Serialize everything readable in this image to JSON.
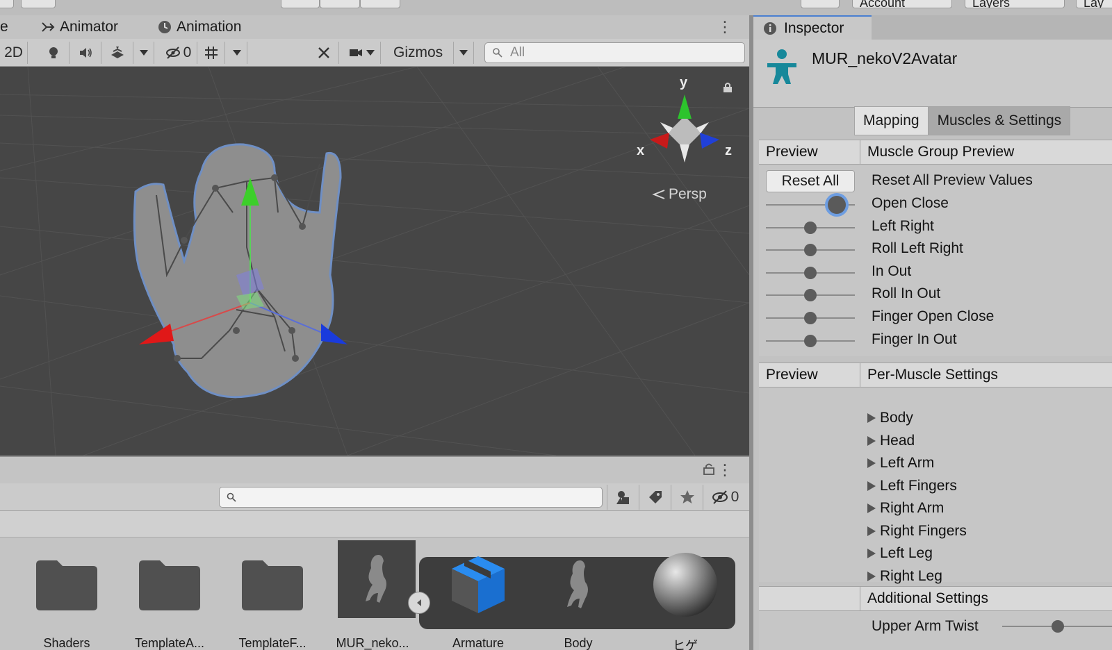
{
  "top_bar": {
    "partial_labels": [
      "Account",
      "Layers",
      "Lay"
    ]
  },
  "scene": {
    "tabs": [
      {
        "label": "e"
      },
      {
        "label": "Animator"
      },
      {
        "label": "Animation"
      }
    ],
    "toolbar": {
      "mode_2d": "2D",
      "hidden_count": "0",
      "gizmos_label": "Gizmos",
      "search_placeholder": "All"
    },
    "viewport": {
      "axis_x": "x",
      "axis_y": "y",
      "axis_z": "z",
      "projection_label": "Persp"
    }
  },
  "project": {
    "hidden_count": "0",
    "assets": [
      {
        "label": "Shaders",
        "icon": "folder-icon"
      },
      {
        "label": "TemplateA...",
        "icon": "folder-icon"
      },
      {
        "label": "TemplateF...",
        "icon": "folder-icon"
      },
      {
        "label": "MUR_neko...",
        "icon": "model-icon",
        "selected": true
      },
      {
        "label": "Armature",
        "icon": "prefab-icon"
      },
      {
        "label": "Body",
        "icon": "mesh-icon"
      },
      {
        "label": "ヒゲ",
        "icon": "material-sphere-icon"
      }
    ]
  },
  "inspector": {
    "tab_label": "Inspector",
    "asset_name": "MUR_nekoV2Avatar",
    "modes": [
      "Mapping",
      "Muscles & Settings"
    ],
    "active_mode": "Muscles & Settings",
    "muscle_group": {
      "preview_label": "Preview",
      "title": "Muscle Group Preview",
      "reset_button": "Reset All",
      "reset_label": "Reset All Preview Values",
      "rows": [
        {
          "label": "Open Close",
          "value": 0.8
        },
        {
          "label": "Left Right",
          "value": 0.5
        },
        {
          "label": "Roll Left Right",
          "value": 0.5
        },
        {
          "label": "In Out",
          "value": 0.5
        },
        {
          "label": "Roll In Out",
          "value": 0.5
        },
        {
          "label": "Finger Open Close",
          "value": 0.5
        },
        {
          "label": "Finger In Out",
          "value": 0.5
        }
      ]
    },
    "per_muscle": {
      "preview_label": "Preview",
      "title": "Per-Muscle Settings",
      "groups": [
        "Body",
        "Head",
        "Left Arm",
        "Left Fingers",
        "Right Arm",
        "Right Fingers",
        "Left Leg",
        "Right Leg"
      ]
    },
    "additional": {
      "title": "Additional Settings",
      "first_row": "Upper Arm Twist",
      "first_row_value": 0.5
    }
  }
}
